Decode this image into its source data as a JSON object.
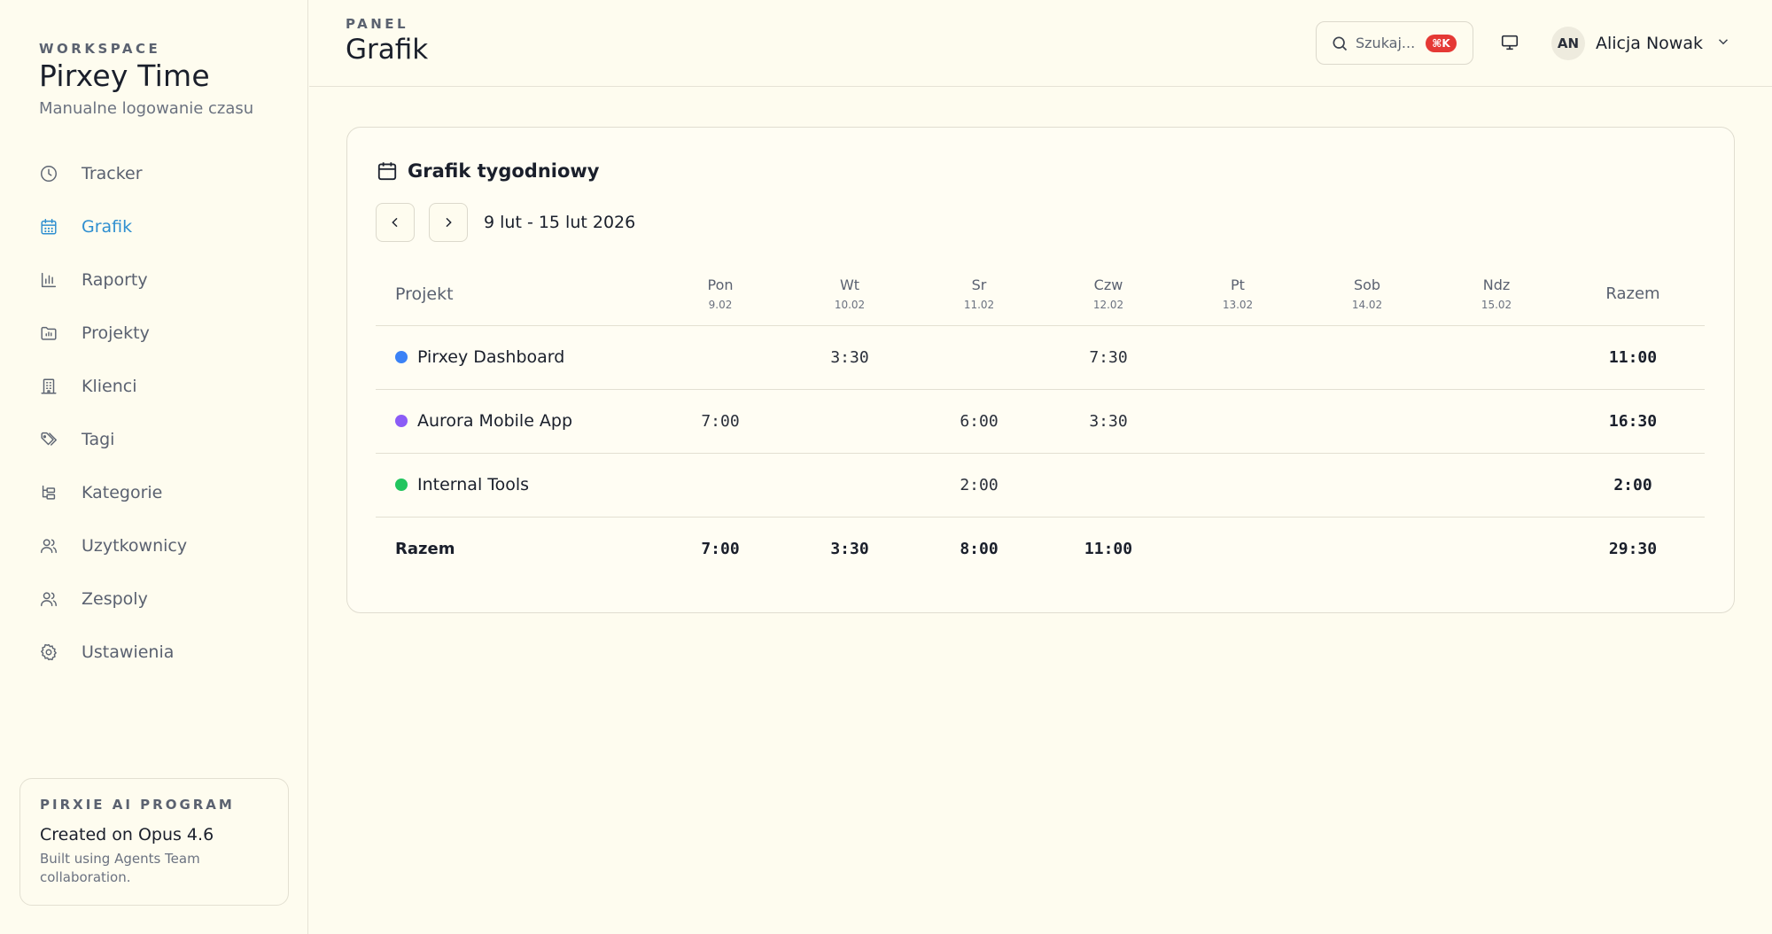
{
  "sidebar": {
    "workspace_label": "WORKSPACE",
    "workspace_name": "Pirxey Time",
    "workspace_subtitle": "Manualne logowanie czasu",
    "items": [
      {
        "label": "Tracker",
        "icon": "clock-icon",
        "active": false
      },
      {
        "label": "Grafik",
        "icon": "calendar-icon",
        "active": true
      },
      {
        "label": "Raporty",
        "icon": "bar-chart-icon",
        "active": false
      },
      {
        "label": "Projekty",
        "icon": "folder-chart-icon",
        "active": false
      },
      {
        "label": "Klienci",
        "icon": "building-icon",
        "active": false
      },
      {
        "label": "Tagi",
        "icon": "tags-icon",
        "active": false
      },
      {
        "label": "Kategorie",
        "icon": "tree-icon",
        "active": false
      },
      {
        "label": "Uzytkownicy",
        "icon": "users-icon",
        "active": false
      },
      {
        "label": "Zespoly",
        "icon": "team-icon",
        "active": false
      },
      {
        "label": "Ustawienia",
        "icon": "gear-icon",
        "active": false
      }
    ],
    "promo": {
      "label": "PIRXIE AI PROGRAM",
      "title": "Created on Opus 4.6",
      "text": "Built using Agents Team collaboration."
    }
  },
  "header": {
    "section_label": "PANEL",
    "title": "Grafik",
    "search_placeholder": "Szukaj...",
    "search_shortcut": "⌘K",
    "user_initials": "AN",
    "user_name": "Alicja Nowak"
  },
  "schedule": {
    "title": "Grafik tygodniowy",
    "week_range": "9 lut - 15 lut 2026",
    "project_header": "Projekt",
    "total_header": "Razem",
    "days": [
      {
        "name": "Pon",
        "date": "9.02"
      },
      {
        "name": "Wt",
        "date": "10.02"
      },
      {
        "name": "Sr",
        "date": "11.02"
      },
      {
        "name": "Czw",
        "date": "12.02"
      },
      {
        "name": "Pt",
        "date": "13.02"
      },
      {
        "name": "Sob",
        "date": "14.02"
      },
      {
        "name": "Ndz",
        "date": "15.02"
      }
    ],
    "rows": [
      {
        "project": "Pirxey Dashboard",
        "color": "#3b82f6",
        "hours": [
          "",
          "3:30",
          "",
          "7:30",
          "",
          "",
          ""
        ],
        "total": "11:00"
      },
      {
        "project": "Aurora Mobile App",
        "color": "#8b5cf6",
        "hours": [
          "7:00",
          "",
          "6:00",
          "3:30",
          "",
          "",
          ""
        ],
        "total": "16:30"
      },
      {
        "project": "Internal Tools",
        "color": "#22c55e",
        "hours": [
          "",
          "",
          "2:00",
          "",
          "",
          "",
          ""
        ],
        "total": "2:00"
      }
    ],
    "totals": {
      "label": "Razem",
      "hours": [
        "7:00",
        "3:30",
        "8:00",
        "11:00",
        "",
        "",
        ""
      ],
      "total": "29:30"
    }
  }
}
